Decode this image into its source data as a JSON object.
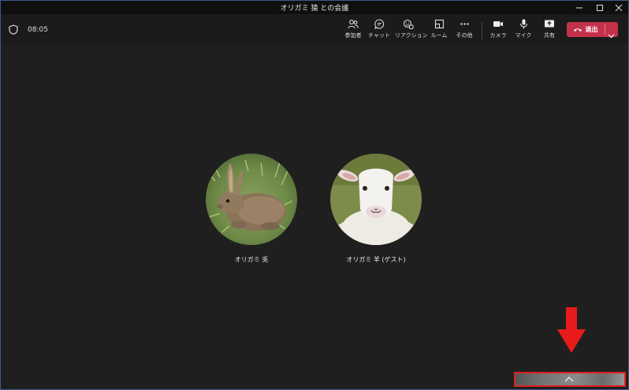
{
  "window": {
    "title": "オリガミ 猿 との会議"
  },
  "toolbar": {
    "timer": "08:05",
    "buttons": {
      "participants": "参加者",
      "chat": "チャット",
      "reactions": "リアクション",
      "rooms": "ルーム",
      "more": "その他",
      "camera": "カメラ",
      "mic": "マイク",
      "share": "共有"
    },
    "leave_label": "退出"
  },
  "participants": [
    {
      "name": "オリガミ 兎",
      "avatar": "rabbit-photo"
    },
    {
      "name": "オリガミ 羊 (ゲスト)",
      "avatar": "sheep-photo"
    }
  ],
  "colors": {
    "leave": "#c4314b",
    "background": "#1f1f1f",
    "highlight": "#e02020"
  },
  "icons": [
    "shield-icon",
    "people-icon",
    "chat-icon",
    "reaction-icon",
    "room-icon",
    "more-icon",
    "camera-icon",
    "mic-icon",
    "share-icon",
    "phone-icon",
    "chevron-down-icon",
    "chevron-up-icon",
    "arrow-down-icon"
  ]
}
